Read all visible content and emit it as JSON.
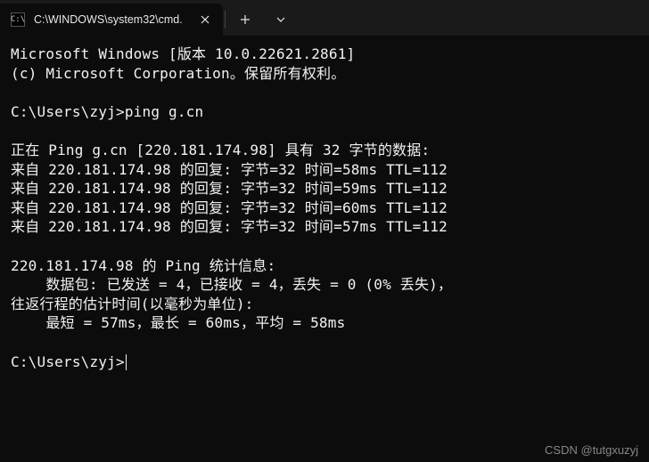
{
  "titleBar": {
    "tabTitle": "C:\\WINDOWS\\system32\\cmd.",
    "tabIconText": "C:\\"
  },
  "terminal": {
    "header1": "Microsoft Windows [版本 10.0.22621.2861]",
    "header2": "(c) Microsoft Corporation。保留所有权利。",
    "prompt1": "C:\\Users\\zyj>",
    "command1": "ping g.cn",
    "pingStart": "正在 Ping g.cn [220.181.174.98] 具有 32 字节的数据:",
    "reply1": "来自 220.181.174.98 的回复: 字节=32 时间=58ms TTL=112",
    "reply2": "来自 220.181.174.98 的回复: 字节=32 时间=59ms TTL=112",
    "reply3": "来自 220.181.174.98 的回复: 字节=32 时间=60ms TTL=112",
    "reply4": "来自 220.181.174.98 的回复: 字节=32 时间=57ms TTL=112",
    "statsHeader": "220.181.174.98 的 Ping 统计信息:",
    "statsPackets": "    数据包: 已发送 = 4，已接收 = 4，丢失 = 0 (0% 丢失)，",
    "statsRtt": "往返行程的估计时间(以毫秒为单位):",
    "statsTimes": "    最短 = 57ms，最长 = 60ms，平均 = 58ms",
    "prompt2": "C:\\Users\\zyj>"
  },
  "watermark": "CSDN @tutgxuzyj"
}
